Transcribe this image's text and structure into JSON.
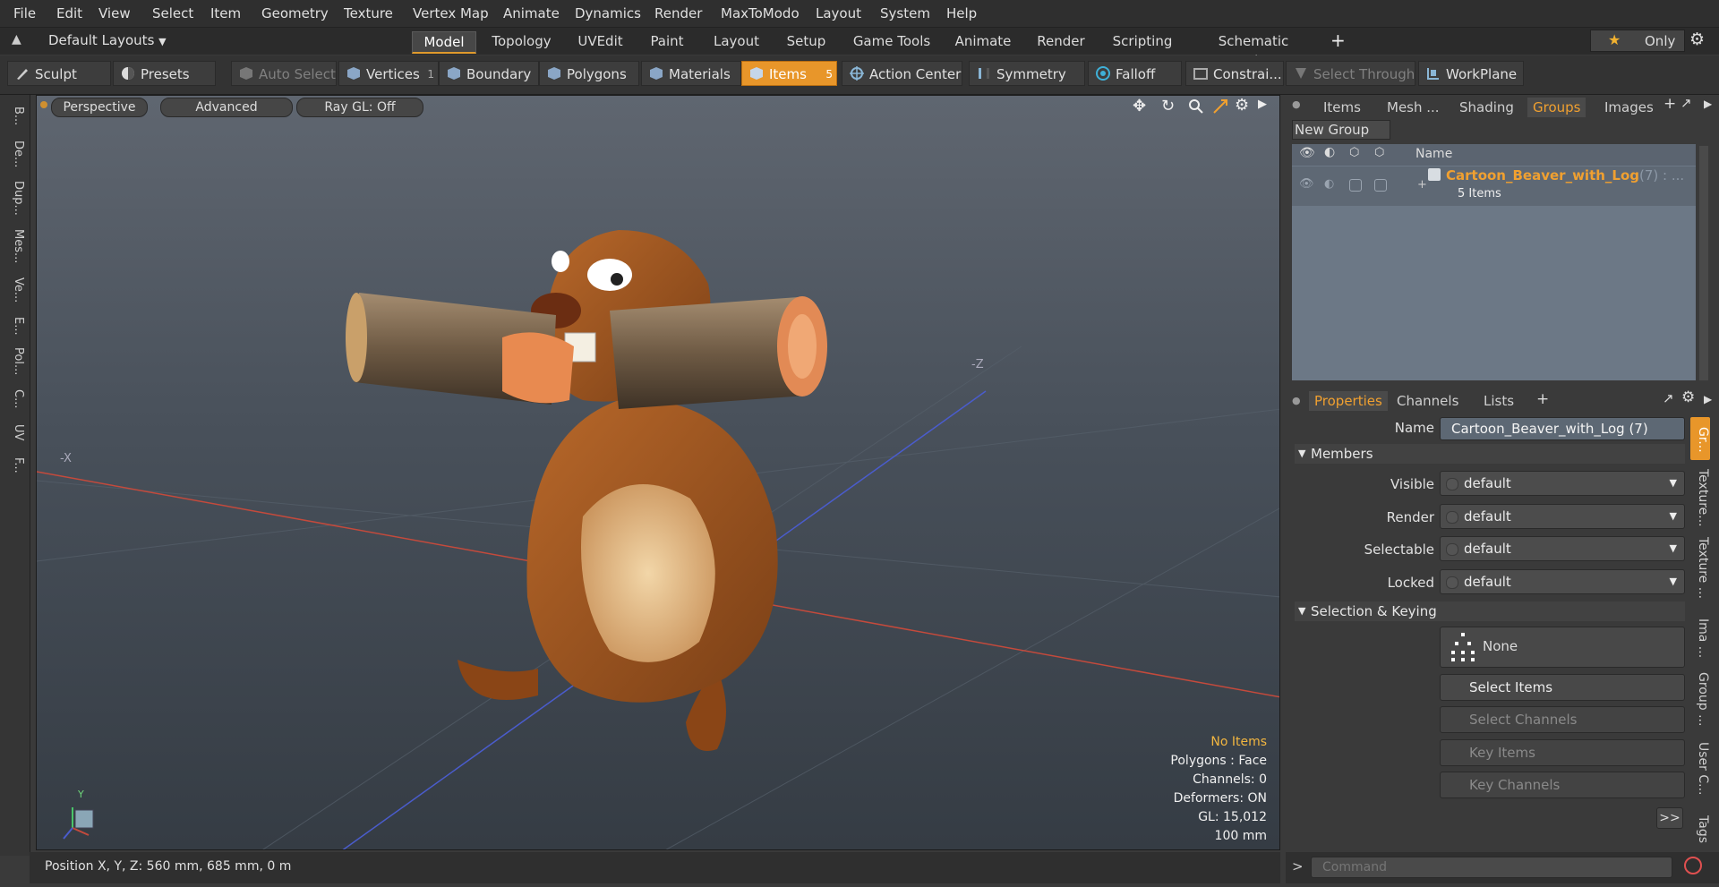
{
  "menu": [
    "File",
    "Edit",
    "View",
    "Select",
    "Item",
    "Geometry",
    "Texture",
    "Vertex Map",
    "Animate",
    "Dynamics",
    "Render",
    "MaxToModo",
    "Layout",
    "System",
    "Help"
  ],
  "layout_selector": "Default Layouts",
  "layout_tabs": [
    "Model",
    "Topology",
    "UVEdit",
    "Paint",
    "Layout",
    "Setup",
    "Game Tools",
    "Animate",
    "Render",
    "Scripting",
    "Schematic Fusion"
  ],
  "only_label": "Only",
  "toolbar": {
    "sculpt": "Sculpt",
    "presets": "Presets",
    "auto_select": "Auto Select",
    "vertices": "Vertices",
    "vertices_count": "1",
    "boundary": "Boundary",
    "polygons": "Polygons",
    "materials": "Materials",
    "items": "Items",
    "items_count": "5",
    "action_center": "Action Center",
    "symmetry": "Symmetry",
    "falloff": "Falloff",
    "constraints": "Constrai...",
    "select_through": "Select Through",
    "workplane": "WorkPlane"
  },
  "left_tabs": [
    "B...",
    "De...",
    "Dup...",
    "Mes...",
    "Ve...",
    "E...",
    "Pol...",
    "C...",
    "UV",
    "F..."
  ],
  "viewport": {
    "perspective": "Perspective",
    "advanced": "Advanced",
    "raygl": "Ray GL: Off",
    "axis_neg_x": "-X",
    "axis_neg_z": "-Z",
    "gizmo_y": "Y",
    "info": {
      "no_items": "No Items",
      "polygons": "Polygons : Face",
      "channels": "Channels: 0",
      "deformers": "Deformers: ON",
      "gl": "GL: 15,012",
      "scale": "100 mm"
    }
  },
  "status": {
    "position": "Position X, Y, Z:   560 mm, 685 mm, 0 m"
  },
  "right_tabs_top": [
    "Items",
    "Mesh ...",
    "Shading",
    "Groups",
    "Images"
  ],
  "new_group": "New Group",
  "group_list": {
    "name_header": "Name",
    "group_name": "Cartoon_Beaver_with_Log",
    "group_suffix": "(7) : ...",
    "group_items": "5 Items"
  },
  "right_tabs_bottom": [
    "Properties",
    "Channels",
    "Lists"
  ],
  "properties": {
    "name_label": "Name",
    "name_value": "Cartoon_Beaver_with_Log (7)",
    "members": "Members",
    "visible_label": "Visible",
    "visible_value": "default",
    "render_label": "Render",
    "render_value": "default",
    "selectable_label": "Selectable",
    "selectable_value": "default",
    "locked_label": "Locked",
    "locked_value": "default",
    "selection_keying": "Selection & Keying",
    "none": "None",
    "select_items": "Select Items",
    "select_channels": "Select Channels",
    "key_items": "Key Items",
    "key_channels": "Key Channels",
    "more": ">>"
  },
  "right_vertical_tabs": [
    "Gr...",
    "Texture...",
    "Texture ...",
    "Ima ...",
    "Group ...",
    "User C...",
    "Tags"
  ],
  "command_placeholder": "Command"
}
